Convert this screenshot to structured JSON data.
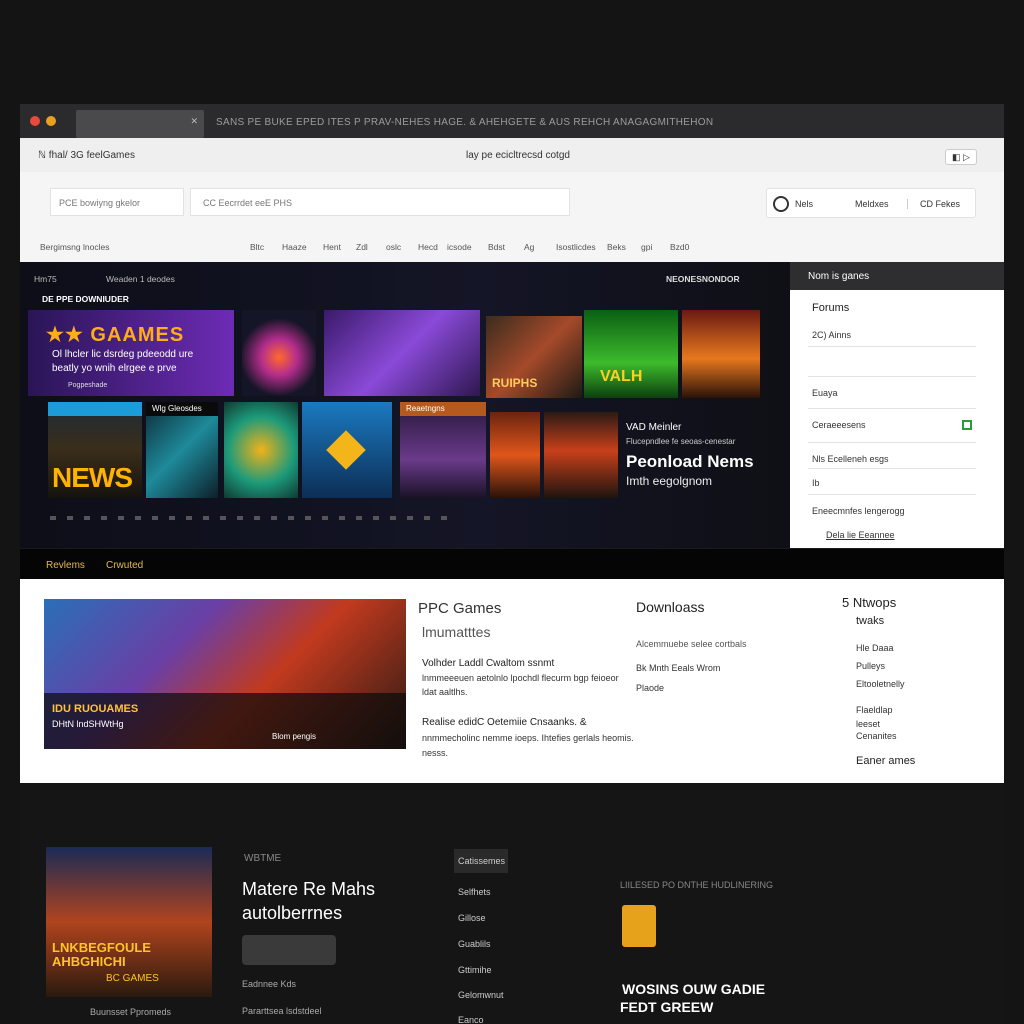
{
  "window": {
    "title": "SANS PE BUKE EPED ITES P PRAV-NEHES HAGE. & AHEHGETE & AUS REHCH ANAGAGMITHEHON"
  },
  "topbar": {
    "left": "ℕ fhal/ 3G feelGames",
    "center": "lay pe ecicltrecsd cotgd",
    "right": "◧ ▷"
  },
  "navbar": {
    "search_left": "PCE bowiyng gkelor",
    "search_main": "CC Eecrrdet eeE PHS",
    "user": {
      "a": "Nels",
      "b": "Meldxes",
      "c": "CD Fekes"
    },
    "menu": [
      "Bergimsng lnocles",
      "Bltc",
      "Haaze",
      "Hent",
      "Zdl",
      "oslc",
      "Hecd",
      "icsode",
      "Bdst",
      "Ag",
      "Isostlicdes",
      "Beks",
      "gpi",
      "Bzd0"
    ]
  },
  "hero": {
    "top_left": "Hm75",
    "top_mid": "Weaden 1 deodes",
    "top_right": "NEONESNONDOR",
    "row_label": "DE PPE DOWNIUDER",
    "banner": {
      "title": "★★ GAAMES",
      "line1": "Ol lhcler lic dsrdeg pdeeodd ure",
      "line2": "beatly yo wnih elrgee e prve",
      "tiny": "Pogpeshade"
    },
    "tile_labels": [
      "RUIPHS",
      "VALH",
      "NEWS",
      "Wlg Gleosdes",
      "Reaetngns"
    ],
    "promo": {
      "kicker": "VAD Meinler",
      "small": "Flucepndlee fe seoas-cenestar",
      "title": "Peonload Nems",
      "sub": "Imth eegolgnom"
    }
  },
  "sidebar": {
    "title": "Nom is ganes",
    "forums": "Forums",
    "items": [
      "2C) Ainns",
      "Euaya",
      "Ceraeeesens",
      "Nls Ecelleneh esgs",
      "Ib",
      "Eneecmnfes lengerogg",
      "Dela lie Eeannee"
    ]
  },
  "strip": {
    "left": "Revlems",
    "right": "Crwuted"
  },
  "section2": {
    "thumb_label": "IDU RUOUAMES",
    "thumb_sub": "DHtN lndSHWtHg",
    "thumb_small": "Blom pengis",
    "heading": "PPC Games",
    "subheading": "lmumatttes",
    "para1_title": "Volhder Laddl Cwaltom ssnmt",
    "para1": "lnmmeeeuen aetolnlo lpochdl flecurm bgp feioeor",
    "para1b": "ldat aaltlhs.",
    "para2_title": "Realise edidC Oetemiie Cnsaanks. &",
    "para2": "nnmmecholinc nemme ioeps. Ihtefies gerlals heomis.",
    "para2b": "nesss.",
    "downloads_title": "Downloass",
    "downloads": [
      "Alcemmuebe selee cortbals",
      "Bk Mnth Eeals Wrom",
      "Plaode"
    ],
    "col3_title": "5 Ntwops",
    "col3_sub": "twaks",
    "col3_items": [
      "Hle Daaa",
      "Pulleys",
      "Eltooletnelly",
      "Flaeldlap",
      "leeset",
      "Cenanites",
      "Eaner ames"
    ]
  },
  "section3": {
    "poster_title": "LNKBEGFOULE AHBGHICHI",
    "poster_sub": "BC GAMES",
    "caption1": "Eadnnee Kds",
    "caption2": "Pararttsea lsdstdeel",
    "heading_small": "WBTME",
    "heading": "Matere Re Mahs",
    "heading2": "autolberrnes",
    "list_title": "Catissemes",
    "list": [
      "Selfhets",
      "Gillose",
      "Guablils",
      "Gttimihe",
      "Gelomwnut",
      "Eanco"
    ],
    "right_label": "LIILESED PO DNTHE HUDLINERING",
    "footer": "WOSINS OUW GADIE",
    "footer2": "FEDT GREEW",
    "bottom_caption": "Buunsset Ppromeds"
  }
}
